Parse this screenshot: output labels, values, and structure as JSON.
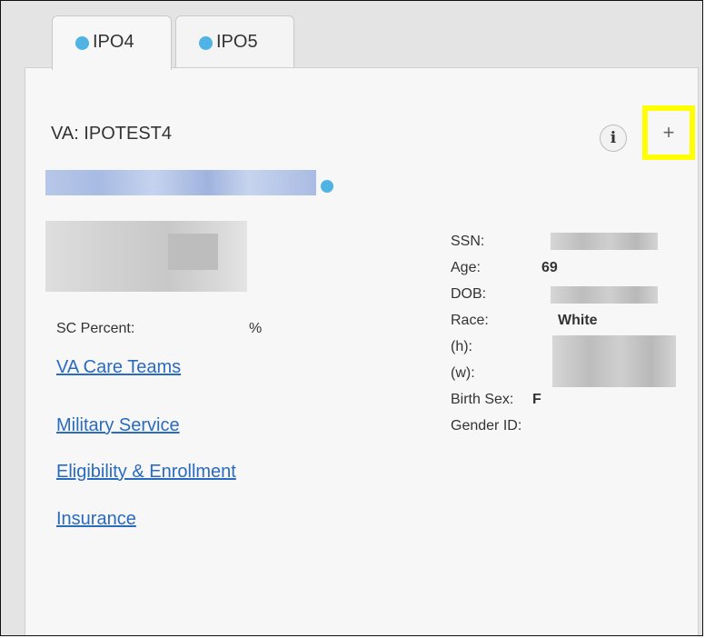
{
  "tabs": [
    {
      "label": "IPO4",
      "status_color": "#4fb3e3",
      "active": true
    },
    {
      "label": "IPO5",
      "status_color": "#4fb3e3",
      "active": false
    }
  ],
  "header": {
    "title": "VA: IPOTEST4",
    "info_icon_glyph": "i",
    "add_icon_glyph": "+"
  },
  "summary": {
    "sc_percent_label": "SC Percent:",
    "sc_percent_value": "%"
  },
  "links": {
    "care_teams": "VA Care Teams",
    "military_service": "Military Service",
    "eligibility": "Eligibility & Enrollment",
    "insurance": "Insurance"
  },
  "demographics": {
    "ssn_label": "SSN:",
    "age_label": "Age:",
    "age_value": "69",
    "dob_label": "DOB:",
    "race_label": "Race:",
    "race_value": "White",
    "home_phone_label": "(h):",
    "work_phone_label": "(w):",
    "birth_sex_label": "Birth Sex:",
    "birth_sex_value": "F",
    "gender_id_label": "Gender ID:"
  },
  "colors": {
    "link": "#2a6bbf",
    "status_dot": "#4fb3e3",
    "highlight": "#ffff00"
  }
}
